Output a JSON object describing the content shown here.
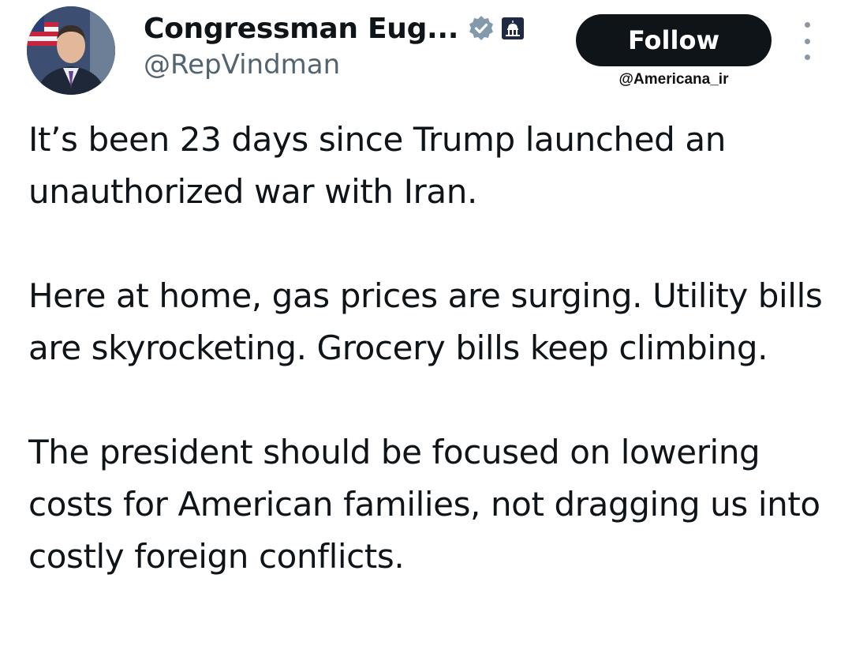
{
  "author": {
    "display_name": "Congressman Eug...",
    "handle": "@RepVindman",
    "avatar_icon": "profile-photo",
    "verified_icon": "verified-badge-icon",
    "affiliation_icon": "capitol-building-icon"
  },
  "actions": {
    "follow_label": "Follow",
    "more_icon": "more-vertical-icon"
  },
  "watermark": "@Americana_ir",
  "tweet": {
    "paragraphs": [
      "It’s been 23 days since Trump launched an unauthorized war with Iran.",
      "Here at home, gas prices are surging. Utility bills are skyrocketing. Grocery bills keep climbing.",
      "The president should be focused on lowering costs for American families, not dragging us into costly foreign conflicts."
    ]
  },
  "colors": {
    "text_primary": "#0f1419",
    "text_secondary": "#536471",
    "button_bg": "#0f1419",
    "button_text": "#ffffff",
    "verified_badge": "#829aab"
  }
}
